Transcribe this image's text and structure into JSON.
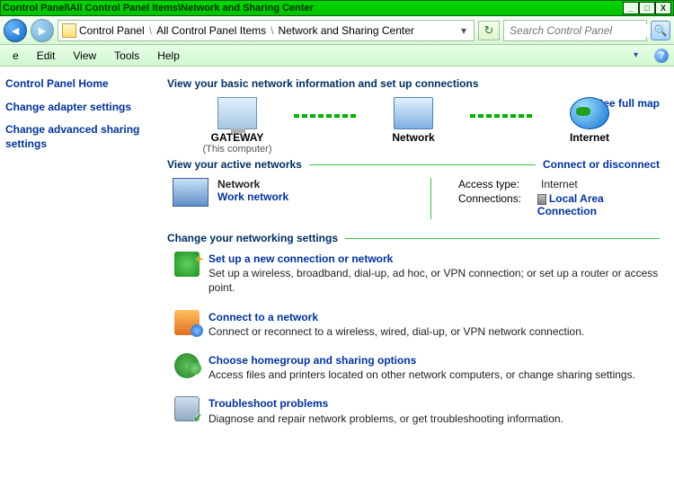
{
  "window": {
    "title": "Control Panel\\All Control Panel Items\\Network and Sharing Center",
    "min": "_",
    "max": "□",
    "close": "X"
  },
  "breadcrumb": {
    "p1": "Control Panel",
    "p2": "All Control Panel Items",
    "p3": "Network and Sharing Center"
  },
  "search": {
    "placeholder": "Search Control Panel"
  },
  "menu": {
    "e": "e",
    "edit": "Edit",
    "view": "View",
    "tools": "Tools",
    "help": "Help"
  },
  "sidebar": {
    "home": "Control Panel Home",
    "adapter": "Change adapter settings",
    "advanced": "Change advanced sharing settings"
  },
  "sections": {
    "info": "View your basic network information and set up connections",
    "active": "View your active networks",
    "change": "Change your networking settings"
  },
  "map": {
    "seefull": "See full map",
    "n1": "GATEWAY",
    "n1sub": "(This computer)",
    "n2": "Network",
    "n3": "Internet",
    "cod": "Connect or disconnect"
  },
  "active": {
    "name": "Network",
    "type": "Work network",
    "access_k": "Access type:",
    "access_v": "Internet",
    "conn_k": "Connections:",
    "conn_v": "Local Area Connection"
  },
  "tasks": {
    "t1": {
      "title": "Set up a new connection or network",
      "desc": "Set up a wireless, broadband, dial-up, ad hoc, or VPN connection; or set up a router or access point."
    },
    "t2": {
      "title": "Connect to a network",
      "desc": "Connect or reconnect to a wireless, wired, dial-up, or VPN network connection."
    },
    "t3": {
      "title": "Choose homegroup and sharing options",
      "desc": "Access files and printers located on other network computers, or change sharing settings."
    },
    "t4": {
      "title": "Troubleshoot problems",
      "desc": "Diagnose and repair network problems, or get troubleshooting information."
    }
  }
}
